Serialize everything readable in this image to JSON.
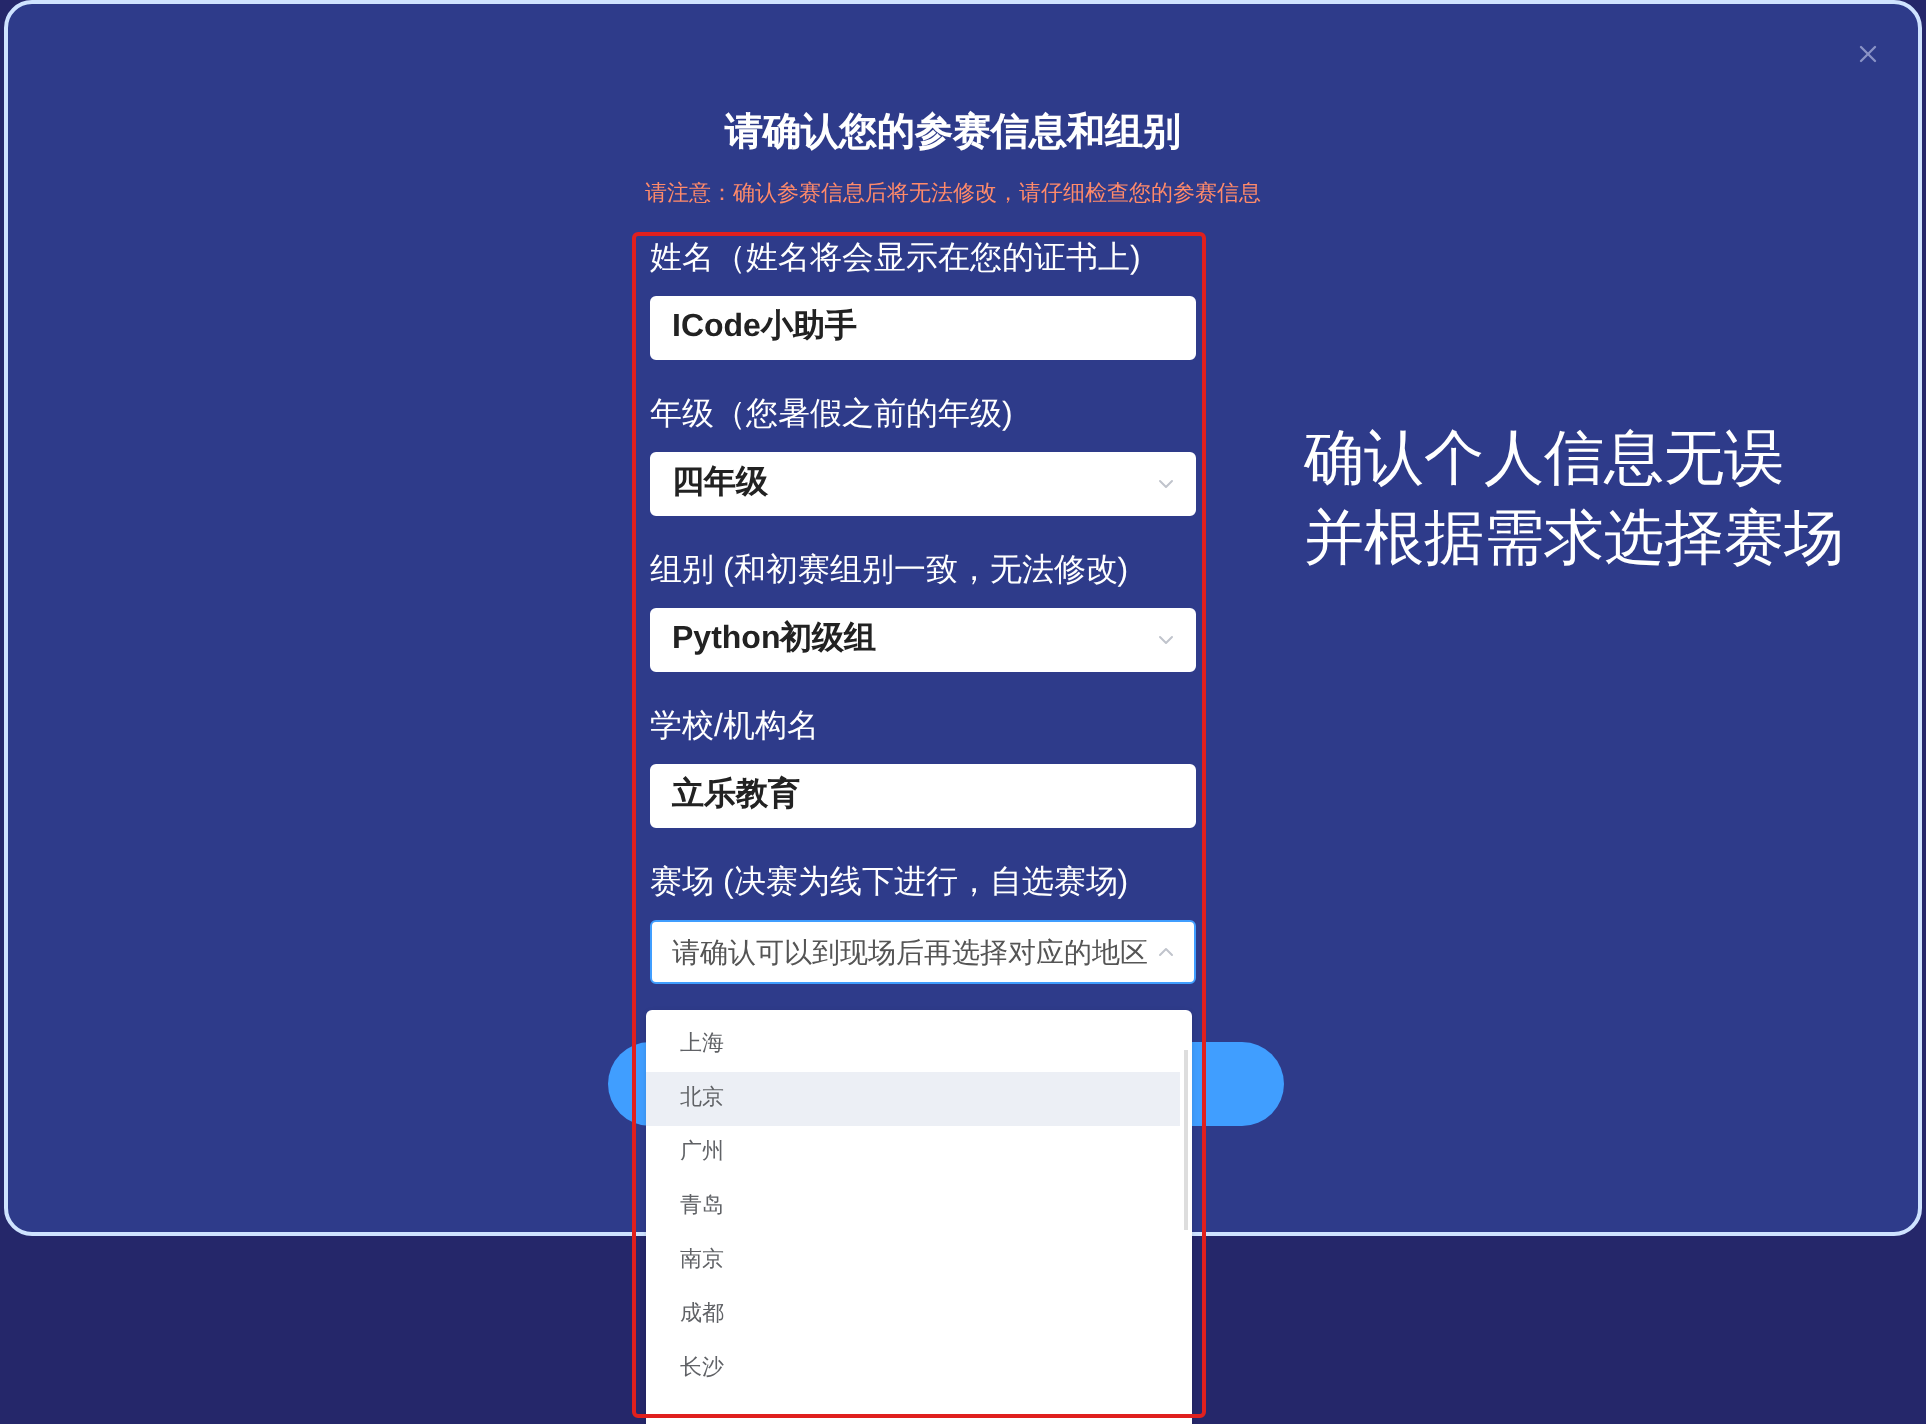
{
  "title": "请确认您的参赛信息和组别",
  "notice": "请注意：确认参赛信息后将无法修改，请仔细检查您的参赛信息",
  "fields": [
    {
      "kind": "input",
      "label": "姓名（姓名将会显示在您的证书上)",
      "value": "ICode小助手"
    },
    {
      "kind": "select",
      "label": "年级（您暑假之前的年级)",
      "value": "四年级",
      "expanded": false
    },
    {
      "kind": "select",
      "label": "组别 (和初赛组别一致，无法修改)",
      "value": "Python初级组",
      "expanded": false
    },
    {
      "kind": "input",
      "label": "学校/机构名",
      "value": "立乐教育"
    },
    {
      "kind": "select",
      "label": "赛场 (决赛为线下进行，自选赛场)",
      "placeholder": "请确认可以到现场后再选择对应的地区",
      "expanded": true
    }
  ],
  "dropdown": {
    "options": [
      {
        "label": "上海",
        "highlighted": false
      },
      {
        "label": "北京",
        "highlighted": true
      },
      {
        "label": "广州",
        "highlighted": false
      },
      {
        "label": "青岛",
        "highlighted": false
      },
      {
        "label": "南京",
        "highlighted": false
      },
      {
        "label": "成都",
        "highlighted": false
      },
      {
        "label": "长沙",
        "highlighted": false
      }
    ]
  },
  "annotation": {
    "lines": [
      "确认个人信息无误",
      "并根据需求选择赛场"
    ]
  }
}
